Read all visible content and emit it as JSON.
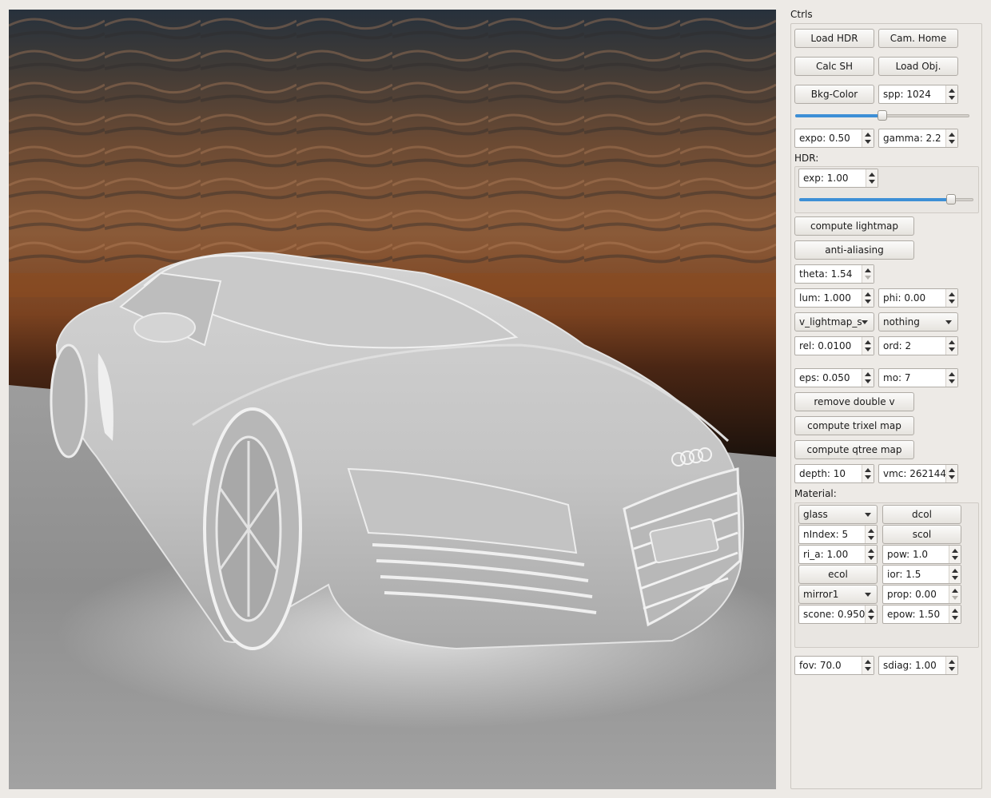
{
  "panel": {
    "title": "Ctrls",
    "buttons": {
      "load_hdr": "Load HDR",
      "cam_home": "Cam. Home",
      "calc_sh": "Calc SH",
      "load_obj": "Load Obj.",
      "bkg_color": "Bkg-Color",
      "compute_lightmap": "compute lightmap",
      "anti_aliasing": "anti-aliasing",
      "remove_double_v": "remove double v",
      "compute_trixel_map": "compute trixel map",
      "compute_qtree_map": "compute qtree map"
    },
    "spp": "spp: 1024",
    "spp_slider_fraction": 0.5,
    "expo": "expo: 0.50",
    "gamma": "gamma: 2.2",
    "hdr_label": "HDR:",
    "hdr_exp": "exp: 1.00",
    "hdr_slider_fraction": 0.87,
    "theta": "theta: 1.54",
    "lum": "lum: 1.000",
    "phi": "phi: 0.00",
    "map_select": "v_lightmap_s",
    "mode_select": "nothing",
    "rel": "rel: 0.0100",
    "ord": "ord: 2",
    "eps": "eps: 0.050",
    "mo": "mo: 7",
    "depth": "depth: 10",
    "vmc": "vmc: 262144",
    "material_label": "Material:",
    "material": {
      "type_select": "glass",
      "dcol": "dcol",
      "nindex": "nIndex: 5",
      "scol": "scol",
      "ri_a": "ri_a: 1.00",
      "pow": "pow: 1.0",
      "ecol": "ecol",
      "ior": "ior: 1.5",
      "mirror_select": "mirror1",
      "prop": "prop: 0.00",
      "scone": "scone: 0.950",
      "epow": "epow: 1.50"
    },
    "fov": "fov: 70.0",
    "sdiag": "sdiag: 1.00"
  }
}
